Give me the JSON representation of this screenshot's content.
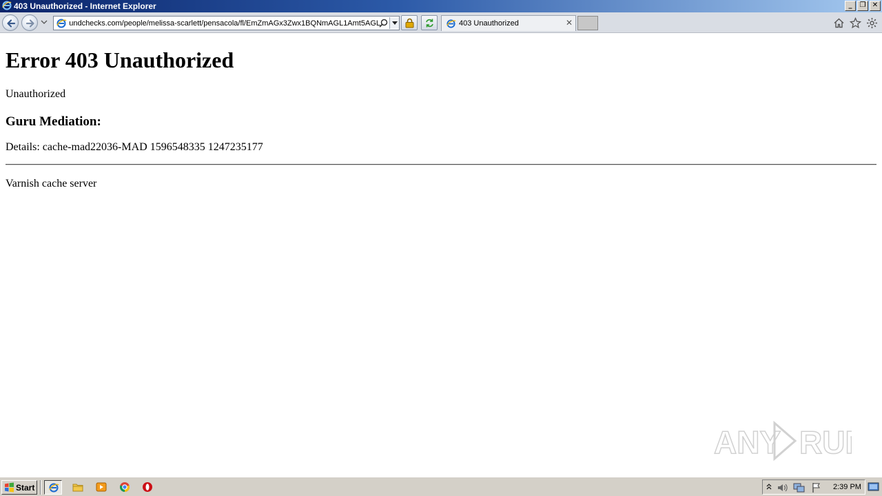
{
  "window": {
    "title": "403 Unauthorized - Internet Explorer",
    "controls": {
      "minimize": "_",
      "restore": "❐",
      "close": "✕"
    }
  },
  "toolbar": {
    "address_url": "https://www.backgroundchecks.com/people/melissa-scarlett/pensacola/fl/EmZmAGx3Zwx1BQNmAGL1Amt5AGL",
    "tab": {
      "label": "403 Unauthorized",
      "close": "✕"
    },
    "icons": [
      "back-arrow-icon",
      "forward-arrow-icon",
      "search-icon",
      "lock-icon",
      "refresh-icon",
      "home-icon",
      "favorites-star-icon",
      "gear-icon"
    ]
  },
  "page": {
    "heading": "Error 403 Unauthorized",
    "message": "Unauthorized",
    "subheading": "Guru Mediation:",
    "details": "Details: cache-mad22036-MAD 1596548335 1247235177",
    "footer": "Varnish cache server"
  },
  "watermark": {
    "text": "ANY RUN"
  },
  "taskbar": {
    "start_label": "Start",
    "clock": "2:39 PM",
    "colors": {
      "opera_red": "#cc0f16",
      "ie_blue": "#1c6bd0"
    }
  }
}
